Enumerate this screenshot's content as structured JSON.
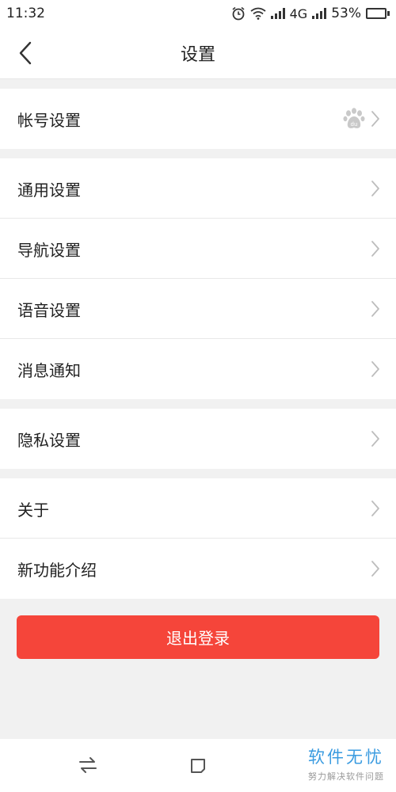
{
  "status_bar": {
    "time": "11:32",
    "network": "4G",
    "battery": "53%",
    "battery_level": 0.53,
    "battery_color": "#3ccd5a"
  },
  "header": {
    "title": "设置"
  },
  "groups": [
    {
      "items": [
        {
          "label": "帐号设置",
          "icon": "baidu-paw-icon"
        }
      ]
    },
    {
      "items": [
        {
          "label": "通用设置"
        },
        {
          "label": "导航设置"
        },
        {
          "label": "语音设置"
        },
        {
          "label": "消息通知"
        }
      ]
    },
    {
      "items": [
        {
          "label": "隐私设置"
        }
      ]
    },
    {
      "items": [
        {
          "label": "关于"
        },
        {
          "label": "新功能介绍"
        }
      ]
    }
  ],
  "logout": {
    "label": "退出登录",
    "color": "#f5453a"
  },
  "watermark": {
    "main": "软件无忧",
    "sub": "努力解决软件问题"
  }
}
